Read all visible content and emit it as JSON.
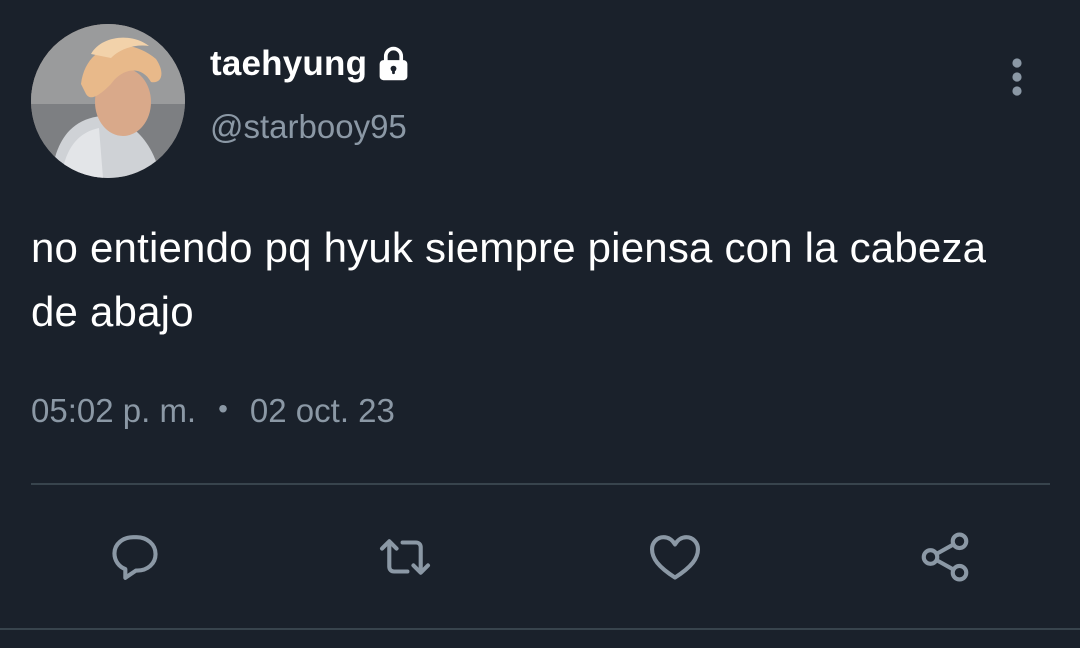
{
  "user": {
    "display_name": "taehyung",
    "handle": "@starbooy95",
    "protected": true,
    "avatar": "profile-photo"
  },
  "tweet": {
    "text": "no entiendo pq hyuk siempre piensa con la cabeza de abajo",
    "time": "05:02 p. m.",
    "separator": "•",
    "date": "02 oct. 23"
  },
  "icons": {
    "lock": "lock-icon",
    "more": "more-vertical-icon",
    "reply": "reply-icon",
    "retweet": "retweet-icon",
    "like": "heart-icon",
    "share": "share-icon"
  },
  "colors": {
    "background": "#1a212b",
    "primary_text": "#ffffff",
    "secondary_text": "#8b98a5",
    "divider": "#38444d"
  }
}
